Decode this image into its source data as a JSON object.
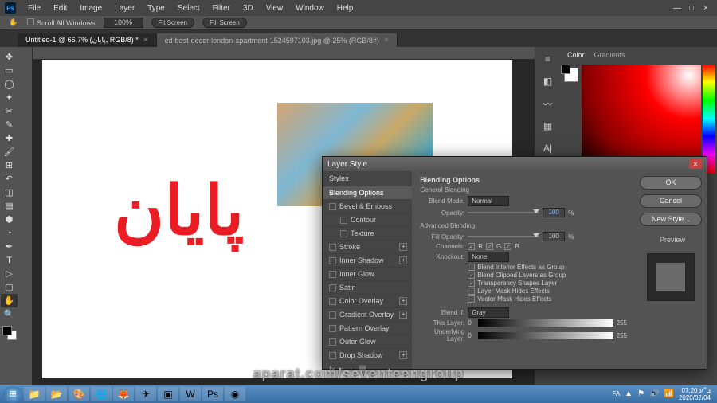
{
  "app": {
    "name": "Ps"
  },
  "menu": [
    "File",
    "Edit",
    "Image",
    "Layer",
    "Type",
    "Select",
    "Filter",
    "3D",
    "View",
    "Window",
    "Help"
  ],
  "options": {
    "scroll_all": "Scroll All Windows",
    "zoom": "100%",
    "btn1": "Fit Screen",
    "btn2": "Fill Screen"
  },
  "tabs": [
    {
      "label": "Untitled-1 @ 66.7% (پایان, RGB/8) *",
      "active": true
    },
    {
      "label": "ed-best-decor-london-apartment-1524597103.jpg @ 25% (RGB/8#)",
      "active": false
    }
  ],
  "canvas": {
    "text": "پایان"
  },
  "panels": {
    "color_tab": "Color",
    "grad_tab": "Gradients"
  },
  "dialog": {
    "title": "Layer Style",
    "styles_header": "Styles",
    "styles": [
      {
        "label": "Blending Options",
        "sel": true,
        "cb": false
      },
      {
        "label": "Bevel & Emboss",
        "cb": true
      },
      {
        "label": "Contour",
        "cb": true,
        "indent": true
      },
      {
        "label": "Texture",
        "cb": true,
        "indent": true
      },
      {
        "label": "Stroke",
        "cb": true,
        "plus": true
      },
      {
        "label": "Inner Shadow",
        "cb": true,
        "plus": true
      },
      {
        "label": "Inner Glow",
        "cb": true
      },
      {
        "label": "Satin",
        "cb": true
      },
      {
        "label": "Color Overlay",
        "cb": true,
        "plus": true
      },
      {
        "label": "Gradient Overlay",
        "cb": true,
        "plus": true
      },
      {
        "label": "Pattern Overlay",
        "cb": true
      },
      {
        "label": "Outer Glow",
        "cb": true
      },
      {
        "label": "Drop Shadow",
        "cb": true,
        "plus": true
      }
    ],
    "section_title": "Blending Options",
    "general": "General Blending",
    "blend_mode_lbl": "Blend Mode:",
    "blend_mode_val": "Normal",
    "opacity_lbl": "Opacity:",
    "opacity_val": "100",
    "advanced": "Advanced Blending",
    "fill_lbl": "Fill Opacity:",
    "fill_val": "100",
    "channels_lbl": "Channels:",
    "ch_r": "R",
    "ch_g": "G",
    "ch_b": "B",
    "knockout_lbl": "Knockout:",
    "knockout_val": "None",
    "opts": [
      {
        "label": "Blend Interior Effects as Group",
        "on": false
      },
      {
        "label": "Blend Clipped Layers as Group",
        "on": true
      },
      {
        "label": "Transparency Shapes Layer",
        "on": true
      },
      {
        "label": "Layer Mask Hides Effects",
        "on": false
      },
      {
        "label": "Vector Mask Hides Effects",
        "on": false
      }
    ],
    "blendif_lbl": "Blend If:",
    "blendif_val": "Gray",
    "this_layer": "This Layer:",
    "this_lo": "0",
    "this_hi": "255",
    "under_layer": "Underlying Layer:",
    "under_lo": "0",
    "under_hi": "255",
    "btn_ok": "OK",
    "btn_cancel": "Cancel",
    "btn_new": "New Style...",
    "preview": "Preview"
  },
  "watermark": "aparat.com/seventeengroup",
  "taskbar": {
    "lang": "FA",
    "time": "07:20 ב״ע",
    "date": "2020/02/04"
  }
}
